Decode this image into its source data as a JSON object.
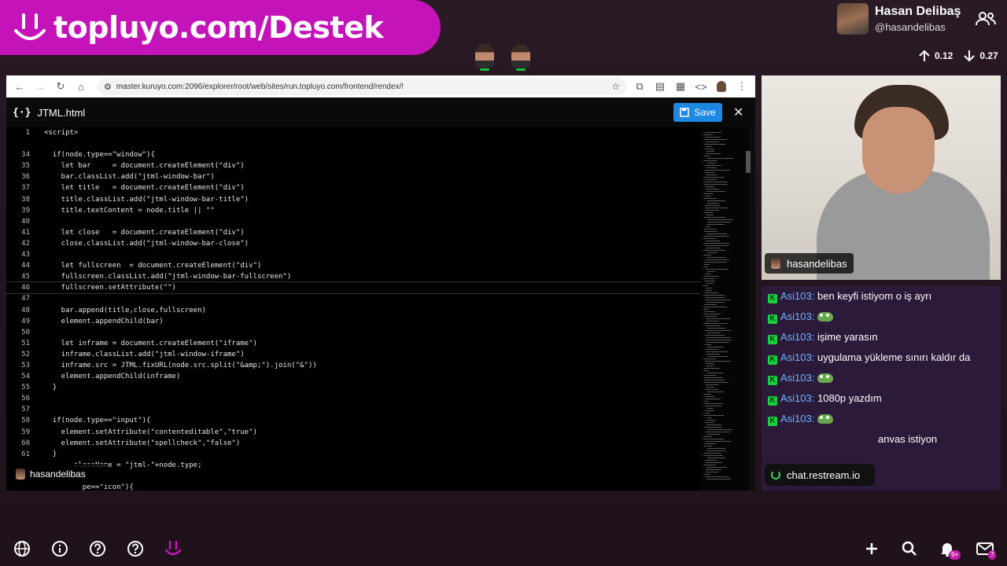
{
  "banner": {
    "text": "topluyo.com/Destek"
  },
  "profile": {
    "name": "Hasan Delibaş",
    "handle": "@hasandelibas"
  },
  "stats": {
    "up": "0.12",
    "down": "0.27"
  },
  "browser": {
    "url": "master.kuruyo.com:2096/explorer/root/web/sites/run.topluyo.com/frontend/rendex/!"
  },
  "editor": {
    "file_icon": "{·}",
    "file_name": "JTML.html",
    "save_label": "Save",
    "lines": [
      {
        "n": "1",
        "t": "<script>"
      },
      {
        "n": "",
        "t": ""
      },
      {
        "n": "34",
        "t": "  if(node.type==\"window\"){"
      },
      {
        "n": "35",
        "t": "    let bar     = document.createElement(\"div\")"
      },
      {
        "n": "36",
        "t": "    bar.classList.add(\"jtml-window-bar\")"
      },
      {
        "n": "37",
        "t": "    let title   = document.createElement(\"div\")"
      },
      {
        "n": "38",
        "t": "    title.classList.add(\"jtml-window-bar-title\")"
      },
      {
        "n": "39",
        "t": "    title.textContent = node.title || \"\""
      },
      {
        "n": "40",
        "t": ""
      },
      {
        "n": "41",
        "t": "    let close   = document.createElement(\"div\")"
      },
      {
        "n": "42",
        "t": "    close.classList.add(\"jtml-window-bar-close\")"
      },
      {
        "n": "43",
        "t": ""
      },
      {
        "n": "44",
        "t": "    let fullscreen  = document.createElement(\"div\")"
      },
      {
        "n": "45",
        "t": "    fullscreen.classList.add(\"jtml-window-bar-fullscreen\")"
      },
      {
        "n": "46",
        "t": "    fullscreen.setAttribute(\"\")"
      },
      {
        "n": "47",
        "t": ""
      },
      {
        "n": "48",
        "t": "    bar.append(title,close,fullscreen)"
      },
      {
        "n": "49",
        "t": "    element.appendChild(bar)"
      },
      {
        "n": "50",
        "t": ""
      },
      {
        "n": "51",
        "t": "    let inframe = document.createElement(\"iframe\")"
      },
      {
        "n": "52",
        "t": "    inframe.classList.add(\"jtml-window-iframe\")"
      },
      {
        "n": "53",
        "t": "    inframe.src = JTML.fixURL(node.src.split(\"&amp;\").join(\"&\"))"
      },
      {
        "n": "54",
        "t": "    element.appendChild(inframe)"
      },
      {
        "n": "55",
        "t": "  }"
      },
      {
        "n": "56",
        "t": ""
      },
      {
        "n": "57",
        "t": ""
      },
      {
        "n": "58",
        "t": "  if(node.type==\"input\"){"
      },
      {
        "n": "59",
        "t": "    element.setAttribute(\"contenteditable\",\"true\")"
      },
      {
        "n": "60",
        "t": "    element.setAttribute(\"spellcheck\",\"false\")"
      },
      {
        "n": "61",
        "t": "  }"
      },
      {
        "n": "",
        "t": "       className = \"jtml-\"+node.type;"
      },
      {
        "n": "",
        "t": ""
      },
      {
        "n": "",
        "t": "         pe==\"icon\"){"
      }
    ]
  },
  "caption": {
    "name": "hasandelibas"
  },
  "webcam": {
    "label": "hasandelibas"
  },
  "chat": {
    "messages": [
      {
        "user": "Asi103:",
        "text": "ben keyfi istiyom o iş ayrı",
        "emote": false
      },
      {
        "user": "Asi103:",
        "text": "",
        "emote": true
      },
      {
        "user": "Asi103:",
        "text": "işime yarasın",
        "emote": false
      },
      {
        "user": "Asi103:",
        "text": "uygulama yükleme sınırı kaldır da",
        "emote": false
      },
      {
        "user": "Asi103:",
        "text": "",
        "emote": true
      },
      {
        "user": "Asi103:",
        "text": "1080p yazdım",
        "emote": false
      },
      {
        "user": "Asi103:",
        "text": "",
        "emote": true
      },
      {
        "user": "",
        "text": "anvas istiyon",
        "emote": false
      }
    ],
    "pill": "chat.restream.io"
  },
  "bottom": {
    "bell_badge": "9+",
    "mail_badge": "7"
  },
  "colors": {
    "banner": "#c413b8",
    "save": "#1e88e5",
    "badge": "#18d13f"
  }
}
